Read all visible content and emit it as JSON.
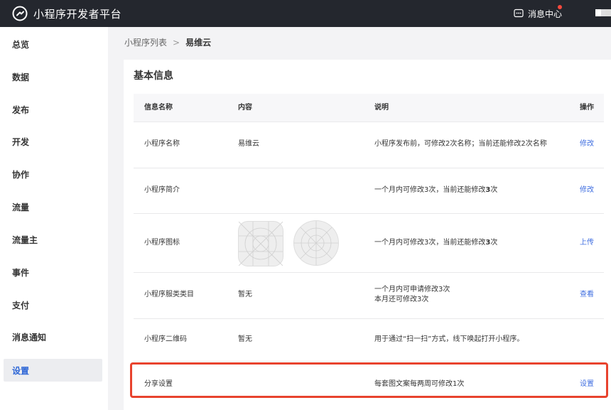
{
  "header": {
    "app_title": "小程序开发者平台",
    "message_center": "消息中心",
    "logo_icon": "miniprogram-logo-icon",
    "message_icon": "message-icon"
  },
  "sidebar": {
    "items": [
      {
        "label": "总览"
      },
      {
        "label": "数据"
      },
      {
        "label": "发布"
      },
      {
        "label": "开发"
      },
      {
        "label": "协作"
      },
      {
        "label": "流量"
      },
      {
        "label": "流量主"
      },
      {
        "label": "事件"
      },
      {
        "label": "支付"
      },
      {
        "label": "消息通知"
      },
      {
        "label": "设置",
        "active": true
      }
    ]
  },
  "breadcrumb": {
    "parent": "小程序列表",
    "separator": ">",
    "current": "易维云"
  },
  "section": {
    "title": "基本信息"
  },
  "table": {
    "headers": [
      "信息名称",
      "内容",
      "说明",
      "操作"
    ],
    "rows": [
      {
        "name": "小程序名称",
        "content": "易维云",
        "desc_pre": "小程序发布前，可修改2次名称；当前还能修改2次名称",
        "desc_bold": "",
        "desc_line2": "",
        "action": "修改"
      },
      {
        "name": "小程序简介",
        "content": "",
        "desc_pre": "一个月内可修改3次，当前还能修改",
        "desc_bold": "3",
        "desc_post": "次",
        "desc_line2": "",
        "action": "修改"
      },
      {
        "name": "小程序图标",
        "content": "",
        "desc_pre": "一个月内可修改3次，当前还能修改",
        "desc_bold": "3",
        "desc_post": "次",
        "desc_line2": "",
        "action": "上传"
      },
      {
        "name": "小程序服类类目",
        "content": "暂无",
        "desc_pre": "一个月内可申请修改3次",
        "desc_bold": "",
        "desc_line2": "本月还可修改3次",
        "action": "查看"
      },
      {
        "name": "小程序二维码",
        "content": "暂无",
        "desc_pre": "用于通过“扫一扫”方式，线下唤起打开小程序。",
        "desc_bold": "",
        "desc_line2": "",
        "action": ""
      },
      {
        "name": "分享设置",
        "content": "",
        "desc_pre": "每套图文案每两周可修改1次",
        "desc_bold": "",
        "desc_line2": "",
        "action": "设置"
      }
    ]
  },
  "colors": {
    "topbar": "#24272e",
    "accent": "#3f6ee0",
    "highlight": "#e8432e",
    "badge": "#f5493d"
  }
}
